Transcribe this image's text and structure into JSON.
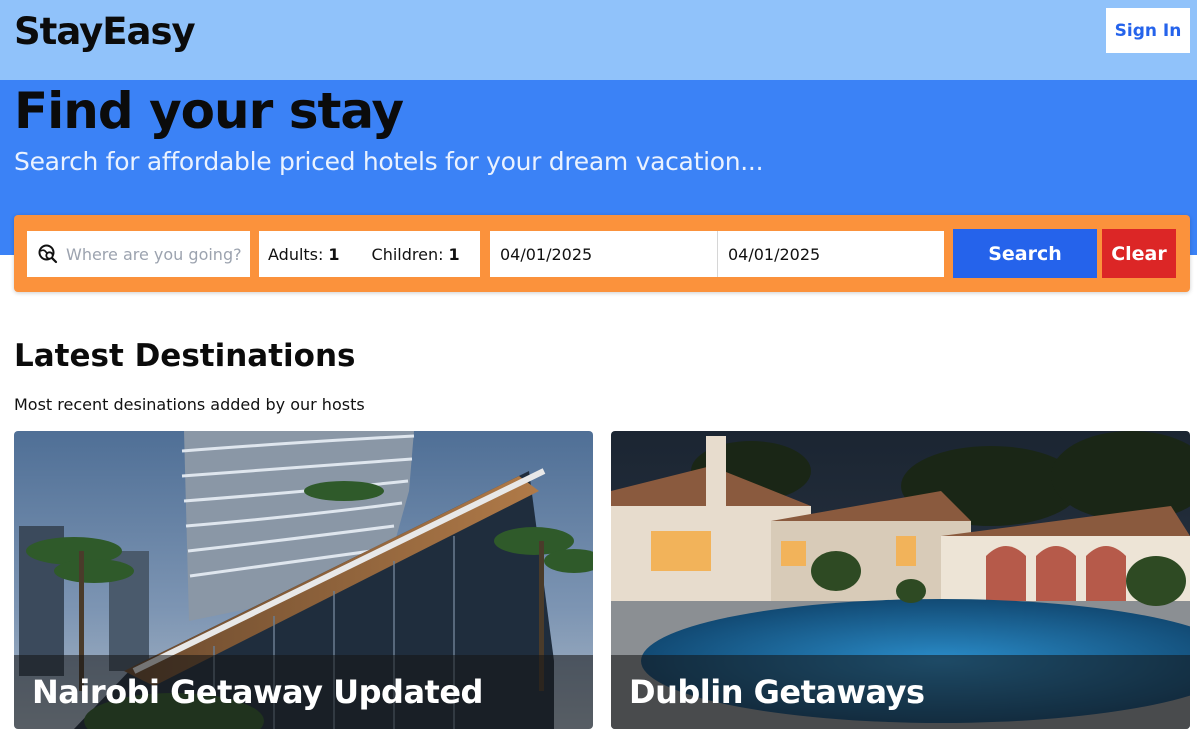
{
  "header": {
    "logo": "StayEasy",
    "sign_in_label": "Sign In"
  },
  "hero": {
    "title": "Find your stay",
    "subtitle": "Search for affordable priced hotels for your dream vacation..."
  },
  "search": {
    "destination_placeholder": "Where are you going?",
    "destination_value": "",
    "adults_label": "Adults:",
    "adults_value": "1",
    "children_label": "Children:",
    "children_value": "1",
    "check_in": "04/01/2025",
    "check_out": "04/01/2025",
    "search_label": "Search",
    "clear_label": "Clear"
  },
  "latest": {
    "title": "Latest Destinations",
    "subtitle": "Most recent desinations added by our hosts",
    "cards": [
      {
        "title": "Nairobi Getaway Updated"
      },
      {
        "title": "Dublin Getaways"
      }
    ]
  },
  "colors": {
    "topbar": "#90c2fa",
    "hero": "#3b82f6",
    "searchbar": "#fb923c",
    "search_button": "#2563eb",
    "clear_button": "#dc2626"
  }
}
